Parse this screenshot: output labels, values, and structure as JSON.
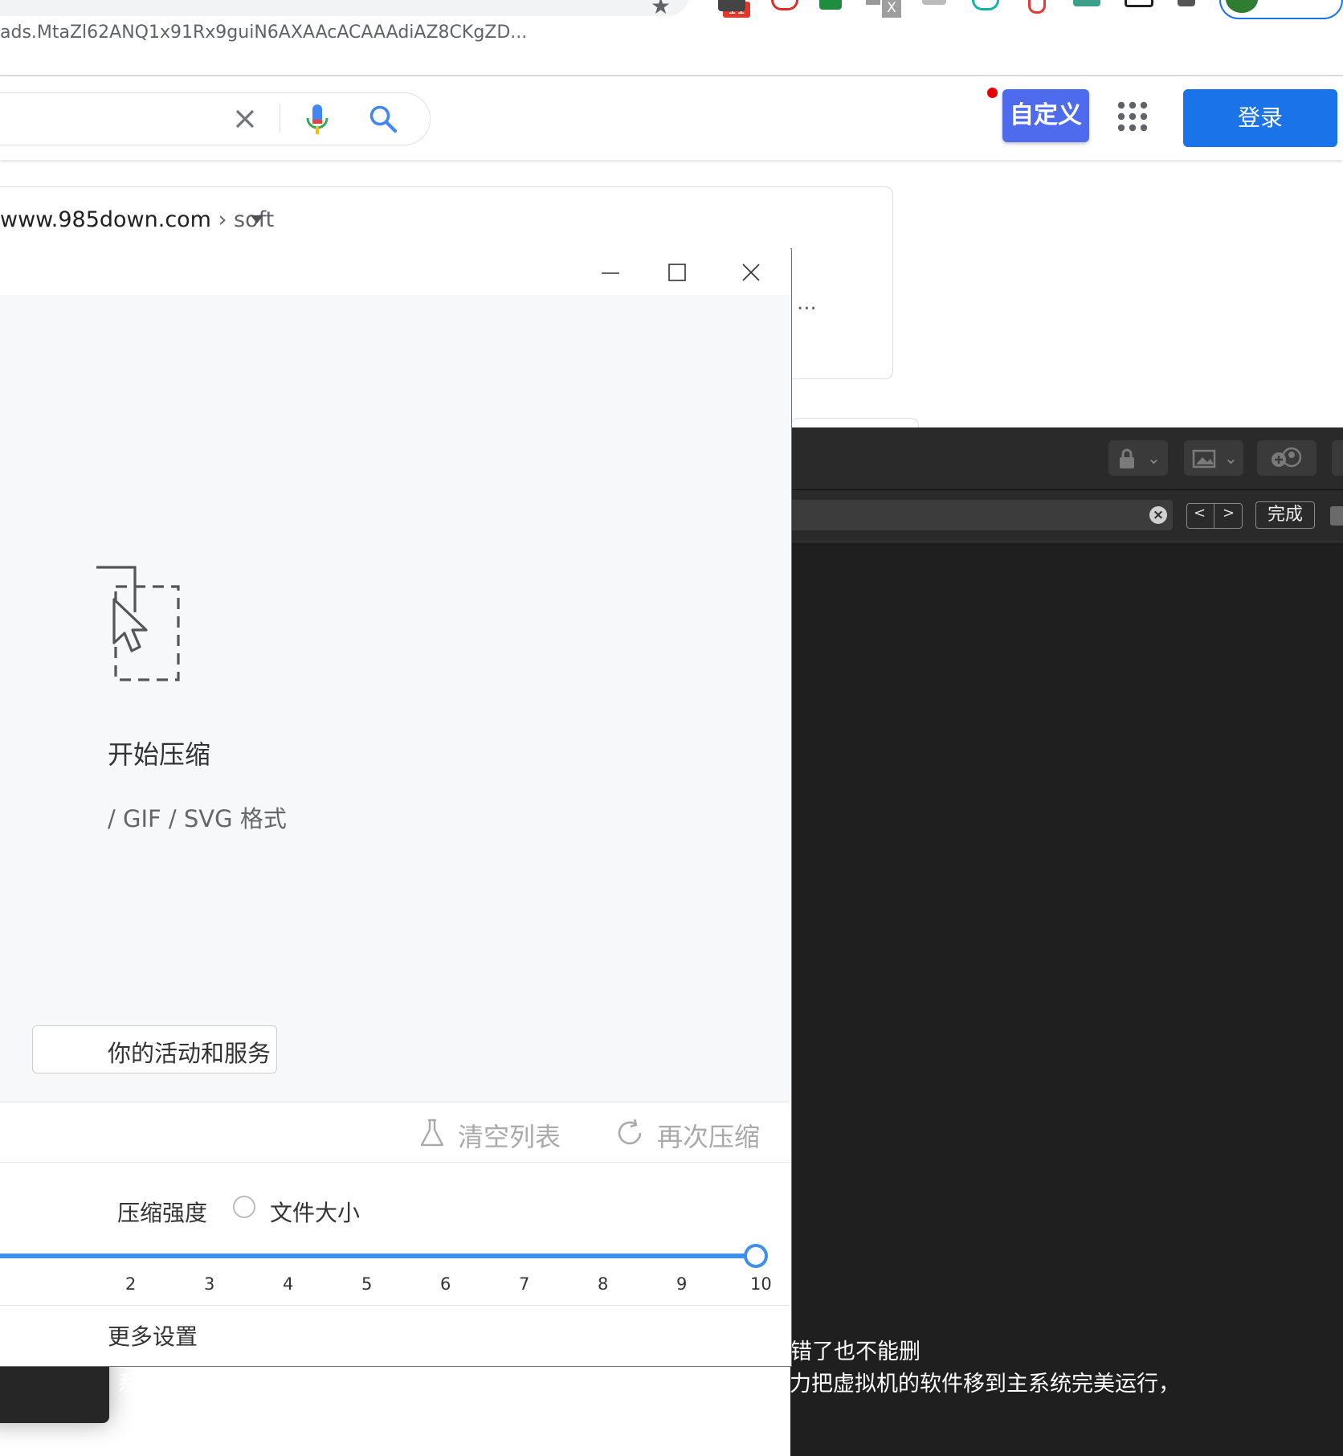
{
  "browser": {
    "url_fragment": "ads.MtaZl62ANQ1x91Rx9guiN6AXAAcACAAAdiAZ8CKgZD...",
    "extension_badge": "11",
    "extension_icons": [
      "extension-badge-icon",
      "extension-red-icon",
      "extension-green-icon",
      "extension-x-icon",
      "extension-white-icon",
      "extension-teal-icon",
      "extension-red-clip-icon",
      "extension-green-square-icon",
      "extension-box-icon",
      "extension-puzzle-icon"
    ]
  },
  "google": {
    "custom_button": "自定义",
    "signin_button": "登录"
  },
  "result": {
    "url_domain": "www.985down.com",
    "url_separator": "›",
    "url_path": "soft",
    "more": "..."
  },
  "dark_editor": {
    "find_done": "完成",
    "find_prev": "<",
    "find_next": ">",
    "text_line_1": "错了也不能删",
    "text_line_2": "系统分开代理（内网，外网），软件分开代理很必要（内网，外网）。尽力把虚拟机的软件移到主系统完美运行，"
  },
  "compressor": {
    "drop_title": "开始压缩",
    "drop_formats": "/ GIF / SVG 格式",
    "activity_button": "你的活动和服务",
    "clear_list": "清空列表",
    "recompress": "再次压缩",
    "mode_strength": "压缩强度",
    "mode_size": "文件大小",
    "slider": {
      "value": 10,
      "min": 1,
      "max": 10,
      "ticks": [
        "2",
        "3",
        "4",
        "5",
        "6",
        "7",
        "8",
        "9",
        "10"
      ]
    },
    "more_settings": "更多设置"
  },
  "colors": {
    "accent_blue": "#1a73e8",
    "custom_button": "#4f6bed",
    "slider": "#3f8fec",
    "dark_bg": "#1f1f1f"
  }
}
